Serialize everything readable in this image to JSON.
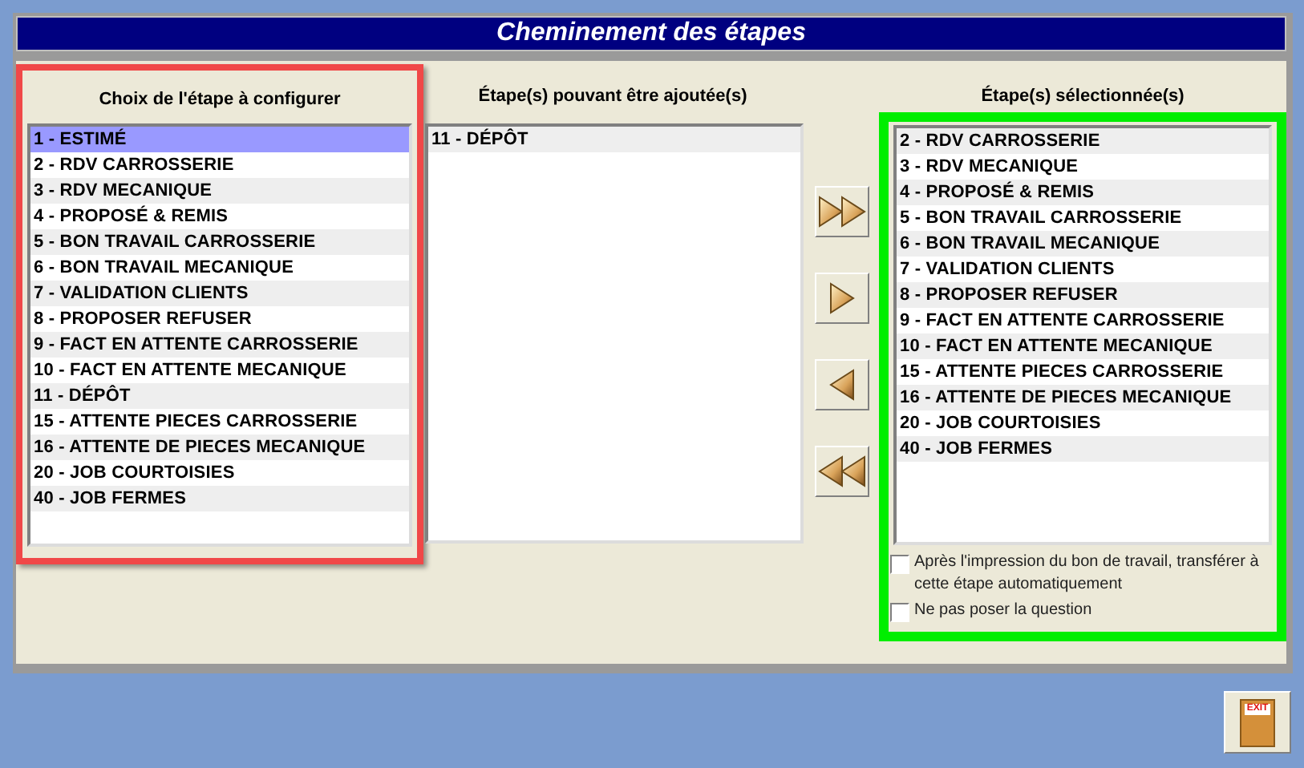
{
  "window": {
    "title": "Cheminement des étapes"
  },
  "left": {
    "heading": "Choix de l'étape à configurer",
    "items": [
      {
        "label": "1 - ESTIMÉ",
        "selected": true
      },
      {
        "label": "2 - RDV CARROSSERIE",
        "selected": false
      },
      {
        "label": "3 - RDV MECANIQUE",
        "selected": false
      },
      {
        "label": "4 - PROPOSÉ & REMIS",
        "selected": false
      },
      {
        "label": "5 - BON TRAVAIL CARROSSERIE",
        "selected": false
      },
      {
        "label": "6 - BON TRAVAIL MECANIQUE",
        "selected": false
      },
      {
        "label": "7 - VALIDATION CLIENTS",
        "selected": false
      },
      {
        "label": "8 - PROPOSER REFUSER",
        "selected": false
      },
      {
        "label": "9 - FACT EN ATTENTE CARROSSERIE",
        "selected": false
      },
      {
        "label": "10 - FACT EN ATTENTE MECANIQUE",
        "selected": false
      },
      {
        "label": "11 - DÉPÔT",
        "selected": false
      },
      {
        "label": "15 - ATTENTE PIECES CARROSSERIE",
        "selected": false
      },
      {
        "label": "16 - ATTENTE DE PIECES MECANIQUE",
        "selected": false
      },
      {
        "label": "20 - JOB COURTOISIES",
        "selected": false
      },
      {
        "label": "40 - JOB FERMES",
        "selected": false
      }
    ]
  },
  "middle": {
    "heading": "Étape(s) pouvant être ajoutée(s)",
    "items": [
      {
        "label": "11 - DÉPÔT",
        "selected": false
      }
    ]
  },
  "transfer_buttons": [
    {
      "kind": "add-all"
    },
    {
      "kind": "add"
    },
    {
      "kind": "remove"
    },
    {
      "kind": "remove-all"
    }
  ],
  "right": {
    "heading": "Étape(s) sélectionnée(s)",
    "items": [
      {
        "label": "2 - RDV CARROSSERIE",
        "selected": false
      },
      {
        "label": "3 - RDV MECANIQUE",
        "selected": false
      },
      {
        "label": "4 - PROPOSÉ & REMIS",
        "selected": false
      },
      {
        "label": "5 - BON TRAVAIL CARROSSERIE",
        "selected": false
      },
      {
        "label": "6 - BON TRAVAIL MECANIQUE",
        "selected": false
      },
      {
        "label": "7 - VALIDATION CLIENTS",
        "selected": false
      },
      {
        "label": "8 - PROPOSER REFUSER",
        "selected": false
      },
      {
        "label": "9 - FACT EN ATTENTE CARROSSERIE",
        "selected": false
      },
      {
        "label": "10 - FACT EN ATTENTE MECANIQUE",
        "selected": false
      },
      {
        "label": "15 - ATTENTE PIECES CARROSSERIE",
        "selected": false
      },
      {
        "label": "16 - ATTENTE DE PIECES MECANIQUE",
        "selected": false
      },
      {
        "label": "20 - JOB COURTOISIES",
        "selected": false
      },
      {
        "label": "40 - JOB FERMES",
        "selected": false
      }
    ],
    "options": [
      {
        "label": "Après l'impression du bon de travail, transférer à cette étape automatiquement",
        "checked": false
      },
      {
        "label": "Ne pas poser la question",
        "checked": false
      }
    ]
  },
  "exit_button": {
    "label": "EXIT"
  }
}
